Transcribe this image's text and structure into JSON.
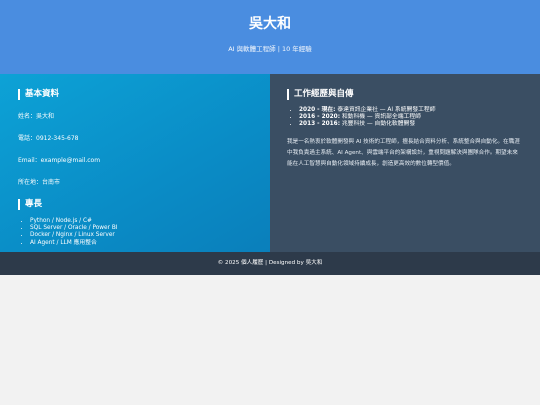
{
  "header": {
    "name": "吳大和",
    "subtitle": "AI 與軟體工程師 | 10 年經驗"
  },
  "basic_info": {
    "title": "基本資料",
    "name_line": "姓名：吳大和",
    "phone_line": "電話：0912-345-678",
    "email_line": "Email：example@mail.com",
    "location_line": "所在地：台南市"
  },
  "skills": {
    "title": "專長",
    "items": [
      "Python / Node.js / C#",
      "SQL Server / Oracle / Power BI",
      "Docker / Nginx / Linux Server",
      "AI Agent / LLM 應用整合"
    ]
  },
  "experience": {
    "title": "工作經歷與自傳",
    "items": [
      {
        "period": "2020 - 現在:",
        "desc": "泰達資訊企業社 — AI 系統開發工程師"
      },
      {
        "period": "2016 - 2020:",
        "desc": "和動科機 — 資訊部全端工程師"
      },
      {
        "period": "2013 - 2016:",
        "desc": "兆豐科技 — 自動化軟體開發"
      }
    ],
    "bio": "我是一名熱衷於軟體開發與 AI 技術的工程師，擅長結合資料分析、系統整合與自動化。在職涯中我負責過主系統、AI Agent、與雲端平台的架構設計，重視問題解決與團隊合作。期望未來能在人工智慧與自動化領域持續成長，創造更高效的數位轉型價值。"
  },
  "footer": {
    "text": "© 2025 個人履歷 | Designed by 吳大和"
  }
}
